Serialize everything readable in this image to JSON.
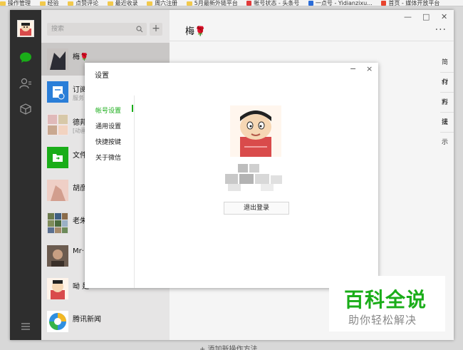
{
  "bookmarks": [
    {
      "label": "操作管理",
      "type": "folder"
    },
    {
      "label": "经验",
      "type": "folder"
    },
    {
      "label": "点赞评论",
      "type": "folder"
    },
    {
      "label": "最近收录",
      "type": "folder"
    },
    {
      "label": "周六注册",
      "type": "folder"
    },
    {
      "label": "5月最新外链平台",
      "type": "folder"
    },
    {
      "label": "帐号状态 - 头条号",
      "type": "site"
    },
    {
      "label": "一点号 - Yidianzixu...",
      "type": "site"
    },
    {
      "label": "首页 - 媒体开放平台",
      "type": "site"
    }
  ],
  "wechat": {
    "search_placeholder": "搜索",
    "add_label": "+",
    "chats": [
      {
        "name": "梅🌹",
        "sub": ""
      },
      {
        "name": "订阅",
        "sub": "服务"
      },
      {
        "name": "德邦",
        "sub": "[动画"
      },
      {
        "name": "文件",
        "sub": ""
      },
      {
        "name": "胡彦",
        "sub": ""
      },
      {
        "name": "老朱",
        "sub": ""
      },
      {
        "name": "Mr·",
        "sub": ""
      },
      {
        "name": "呦 是",
        "sub": ""
      },
      {
        "name": "腾讯新闻",
        "sub": ""
      }
    ],
    "main_title": "梅🌹",
    "window_controls": {
      "min": "—",
      "max": "□",
      "close": "✕"
    },
    "more_label": "···",
    "side_panel": [
      "简介",
      "材料",
      "方法",
      "提示"
    ],
    "add_method_label": "+ 添加新操作方法"
  },
  "dialog": {
    "title": "设置",
    "min_label": "−",
    "close_label": "×",
    "menu": [
      "帐号设置",
      "通用设置",
      "快捷按键",
      "关于微信"
    ],
    "active_index": 0,
    "logout_label": "退出登录"
  },
  "watermark": {
    "main": "百科全说",
    "sub": "助你轻松解决"
  },
  "colors": {
    "accent": "#1aad19",
    "sidebar": "#2e2e2e",
    "list_bg": "#e6e5e5"
  }
}
